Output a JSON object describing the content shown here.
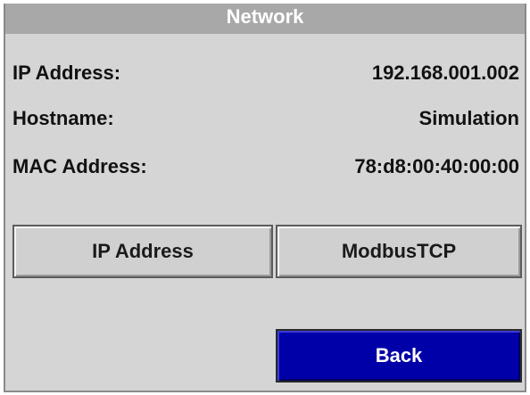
{
  "window": {
    "title": "Network"
  },
  "info": {
    "rows": [
      {
        "label": "IP Address:",
        "value": "192.168.001.002"
      },
      {
        "label": "Hostname:",
        "value": "Simulation"
      },
      {
        "label": "MAC Address:",
        "value": "78:d8:00:40:00:00"
      }
    ]
  },
  "buttons": {
    "ip_address": "IP Address",
    "modbus_tcp": "ModbusTCP",
    "back": "Back"
  },
  "colors": {
    "title_bar": "#a8a8a8",
    "panel_background": "#d5d5d5",
    "back_button": "#0000a8"
  }
}
